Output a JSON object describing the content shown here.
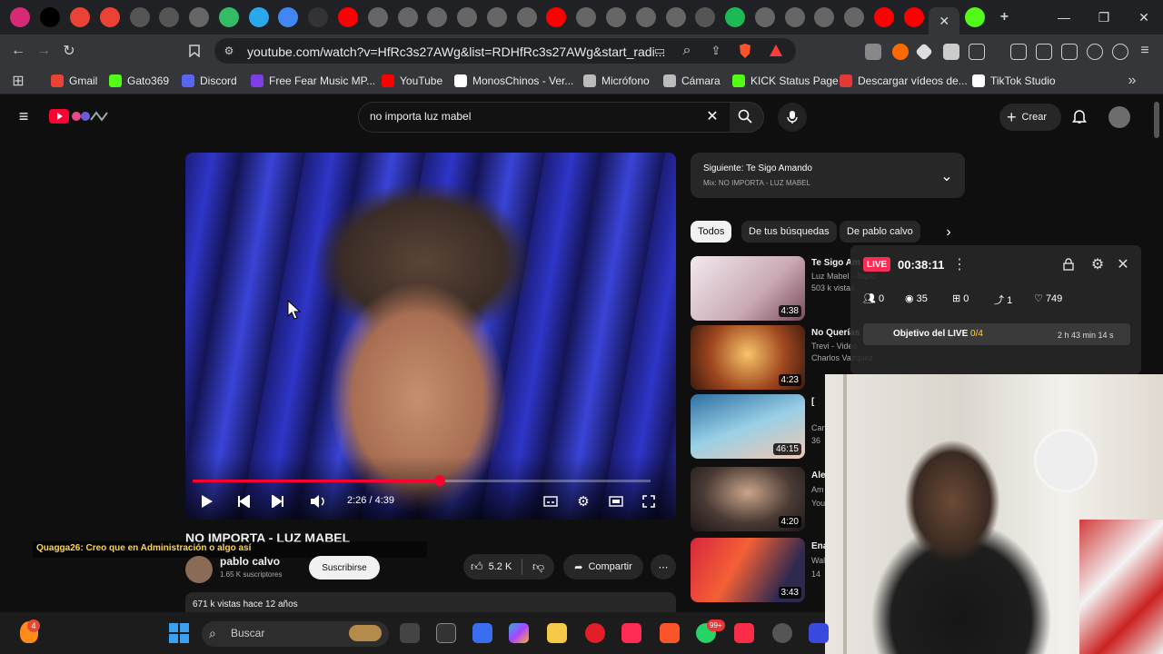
{
  "browser": {
    "url": "youtube.com/watch?v=HfRc3s27AWg&list=RDHfRc3s27AWg&start_radi...",
    "tab_icons": [
      "instagram-icon",
      "x-icon",
      "gmail-icon",
      "gmail-icon",
      "af-icon",
      "af-icon",
      "site-icon",
      "mw-icon",
      "telegram-icon",
      "google-icon",
      "loading-icon",
      "youtube-icon",
      "site-icon",
      "site-icon",
      "site-icon",
      "site-icon",
      "site-icon",
      "site-icon",
      "youtube-icon",
      "site-icon",
      "site-icon",
      "site-icon",
      "site-icon",
      "af-icon",
      "spotify-icon",
      "site-icon",
      "site-icon",
      "site-icon",
      "site-icon",
      "youtube-icon",
      "youtube-icon",
      "active-tab",
      "kick-icon"
    ],
    "bookmarks": [
      {
        "label": "Gmail",
        "color": "#ea4335"
      },
      {
        "label": "Gato369",
        "color": "#53fc18"
      },
      {
        "label": "Discord",
        "color": "#5865f2"
      },
      {
        "label": "Free Fear Music MP...",
        "color": "#7b3fe4"
      },
      {
        "label": "YouTube",
        "color": "#ff0000"
      },
      {
        "label": "MonosChinos - Ver...",
        "color": "#ffffff"
      },
      {
        "label": "Micrófono",
        "color": "#bbbbbb"
      },
      {
        "label": "Cámara",
        "color": "#bbbbbb"
      },
      {
        "label": "KICK Status Page",
        "color": "#53fc18"
      },
      {
        "label": "Descargar vídeos de...",
        "color": "#e53935"
      },
      {
        "label": "TikTok Studio",
        "color": "#ffffff"
      }
    ]
  },
  "youtube": {
    "search_query": "no importa luz mabel",
    "create_label": "Crear",
    "player": {
      "time": "2:26 / 4:39",
      "progress": 0.54
    },
    "title": "NO IMPORTA - LUZ MABEL",
    "channel": "pablo calvo",
    "subscribers": "1.65 K suscriptores",
    "subscribe_label": "Suscribirse",
    "likes": "5.2 K",
    "share_label": "Compartir",
    "views_line": "671 k vistas  hace 12 años",
    "up_next": {
      "label": "Siguiente: Te Sigo Amando",
      "sub": "Mix: NO IMPORTA - LUZ MABEL"
    },
    "chips": [
      "Todos",
      "De tus búsquedas",
      "De pablo calvo"
    ],
    "related": [
      {
        "title": "Te Sigo Am",
        "channel": "Luz Mabel - Topic",
        "meta": "503 k vistas",
        "duration": "4:38"
      },
      {
        "title": "No Querías",
        "channel": "Trevi - Video",
        "meta": "Charlos Vazquez",
        "duration": "4:23"
      },
      {
        "title": "[",
        "channel": "Can",
        "meta": "36",
        "duration": "46:15"
      },
      {
        "title": "Ale",
        "channel": "Am",
        "meta": "You",
        "duration": "4:20"
      },
      {
        "title": "Ena",
        "channel": "Wal",
        "meta": "14",
        "duration": "3:43"
      }
    ]
  },
  "live_overlay": {
    "badge": "LIVE",
    "timer": "00:38:11",
    "stats": [
      {
        "icon": "users-icon",
        "value": "0"
      },
      {
        "icon": "eye-icon",
        "value": "35"
      },
      {
        "icon": "gift-icon",
        "value": "0"
      },
      {
        "icon": "share-icon",
        "value": "1"
      },
      {
        "icon": "heart-icon",
        "value": "749"
      }
    ],
    "goal_label": "Objetivo del LIVE",
    "goal_value": "0/4",
    "goal_time": "2 h 43 min 14 s"
  },
  "chat": {
    "user": "Quagga26",
    "message": ": Creo que en Administración o algo así"
  },
  "taskbar": {
    "search_placeholder": "Buscar",
    "badge": "4",
    "badge2": "99+"
  },
  "colors": {
    "yt_red": "#ff0033",
    "live_pink": "#fe2c55"
  }
}
